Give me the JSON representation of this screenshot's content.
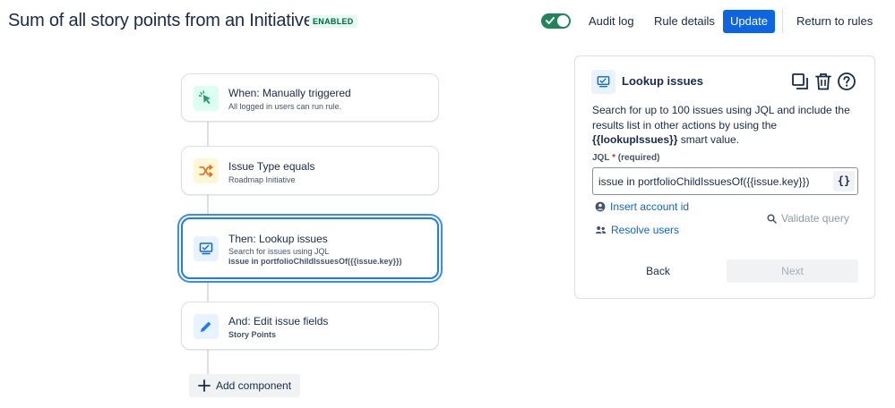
{
  "header": {
    "title": "Sum of all story points from an Initiative",
    "status_badge": "ENABLED",
    "toggle_on": true,
    "audit_log": "Audit log",
    "rule_details": "Rule details",
    "update": "Update",
    "return_to_rules": "Return to rules"
  },
  "flow": {
    "components": [
      {
        "title": "When: Manually triggered",
        "subtitle": "All logged in users can run rule.",
        "icon": "cursor-click-icon",
        "icon_bg": "#dcfff1",
        "icon_color": "#22a06b"
      },
      {
        "title": "Issue Type equals",
        "subtitle": "Roadmap Initiative",
        "icon": "shuffle-icon",
        "icon_bg": "#fff7d6",
        "icon_color": "#e56910"
      },
      {
        "title": "Then: Lookup issues",
        "subtitle": "Search for issues using JQL",
        "detail": "issue in portfolioChildIssuesOf({{issue.key}})",
        "icon": "monitor-icon",
        "icon_bg": "#e9f2ff",
        "icon_color": "#0c66e4",
        "selected": true
      },
      {
        "title": "And: Edit issue fields",
        "subtitle": "Story Points",
        "icon": "pencil-icon",
        "icon_bg": "#e9f2ff",
        "icon_color": "#1d7afc"
      }
    ],
    "add_component": "Add component"
  },
  "panel": {
    "title": "Lookup issues",
    "description_pre": "Search for up to 100 issues using JQL and include the results list in other actions by using the ",
    "description_smart_value": "{{lookupIssues}}",
    "description_post": " smart value.",
    "jql_label": "JQL",
    "jql_required_marker": "*",
    "jql_required_text": "(required)",
    "jql_value": "issue in portfolioChildIssuesOf({{issue.key}})",
    "braces": "{}",
    "insert_account_id": "Insert account id",
    "resolve_users": "Resolve users",
    "validate_query": "Validate query",
    "back": "Back",
    "next": "Next"
  },
  "colors": {
    "primary": "#0c66e4",
    "toggle": "#22845a",
    "selected_border": "#1d7afc"
  }
}
